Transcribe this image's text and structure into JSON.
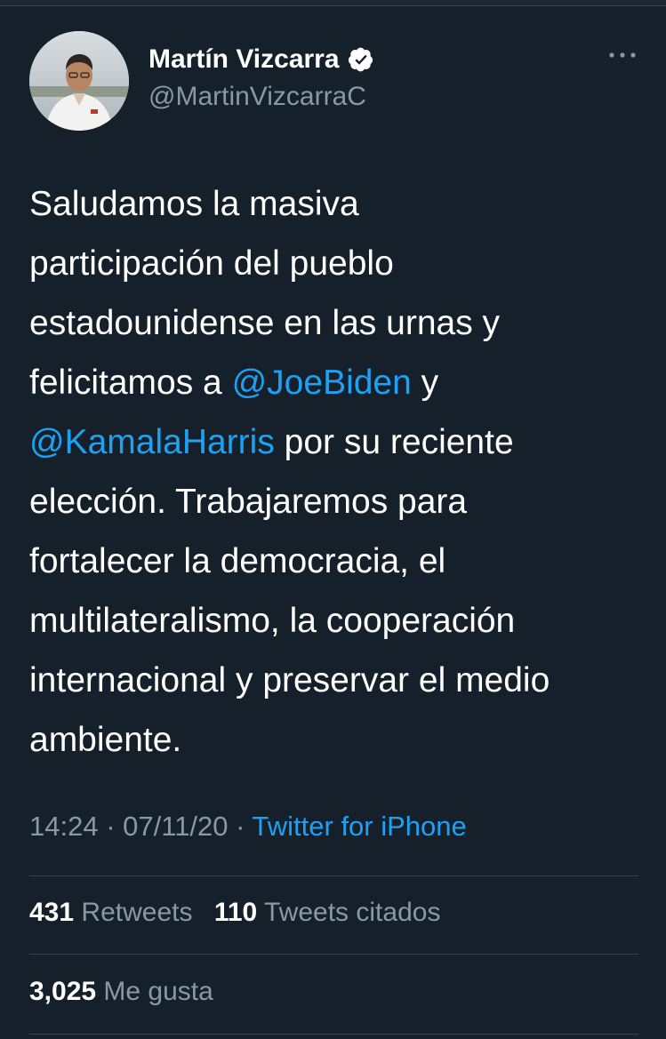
{
  "tweet": {
    "author": {
      "display_name": "Martín Vizcarra",
      "handle": "@MartinVizcarraC",
      "verified": true,
      "avatar_icon": "profile-photo"
    },
    "text_lines": [
      [
        {
          "t": "Saludamos la masiva"
        }
      ],
      [
        {
          "t": "participación del pueblo"
        }
      ],
      [
        {
          "t": "estadounidense en las urnas y"
        }
      ],
      [
        {
          "t": "felicitamos a "
        },
        {
          "t": "@JoeBiden",
          "mention": true
        },
        {
          "t": " y"
        }
      ],
      [
        {
          "t": "@KamalaHarris",
          "mention": true
        },
        {
          "t": " por su reciente"
        }
      ],
      [
        {
          "t": "elección. Trabajaremos para"
        }
      ],
      [
        {
          "t": "fortalecer la democracia, el"
        }
      ],
      [
        {
          "t": "multilateralismo, la cooperación"
        }
      ],
      [
        {
          "t": "internacional y preservar el medio"
        }
      ],
      [
        {
          "t": "ambiente."
        }
      ]
    ],
    "time": "14:24",
    "date": "07/11/20",
    "separator": "·",
    "source": "Twitter for iPhone",
    "stats": {
      "retweets_count": "431",
      "retweets_label": "Retweets",
      "quotes_count": "110",
      "quotes_label": "Tweets citados",
      "likes_count": "3,025",
      "likes_label": "Me gusta"
    }
  },
  "colors": {
    "background": "#15202b",
    "accent": "#1da1f2",
    "secondary_text": "#8899a6",
    "divider": "#38444d"
  },
  "icons": {
    "verified": "verified-badge-icon",
    "more": "more-horizontal-icon"
  }
}
